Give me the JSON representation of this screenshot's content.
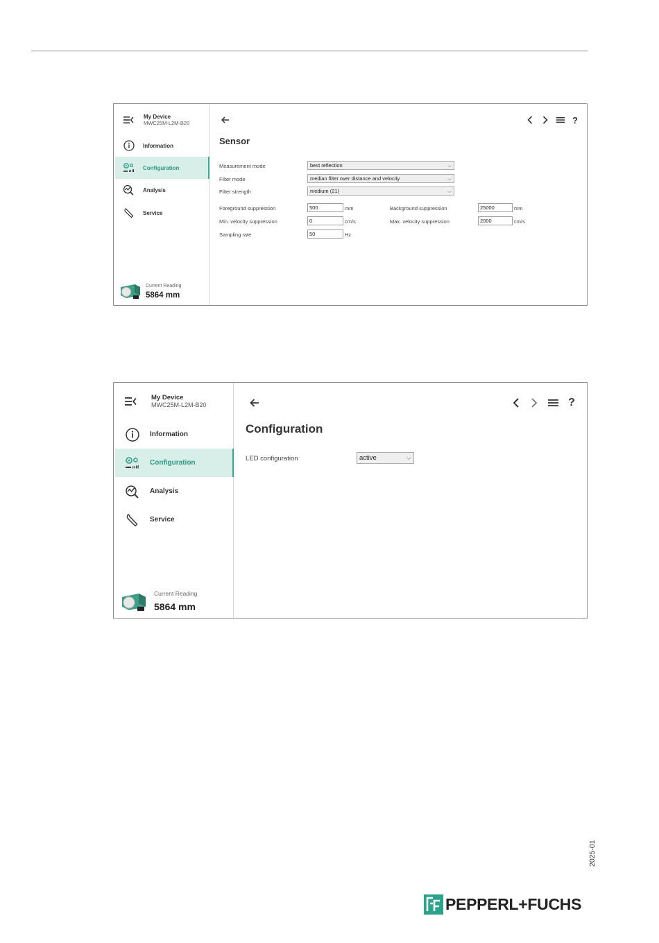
{
  "screens": [
    {
      "device_title": "My Device",
      "device_model": "MWC25M-L2M-B20",
      "nav": [
        {
          "label": "Information",
          "icon": "info-icon",
          "active": false
        },
        {
          "label": "Configuration",
          "icon": "configuration-icon",
          "active": true
        },
        {
          "label": "Analysis",
          "icon": "analysis-icon",
          "active": false
        },
        {
          "label": "Service",
          "icon": "wrench-icon",
          "active": false
        }
      ],
      "reading_label": "Current Reading",
      "reading_value": "5864 mm",
      "toolbar": {
        "back": "back-arrow-icon",
        "prev": "chevron-left-icon",
        "next": "chevron-right-icon",
        "menu": "menu-icon",
        "help": "?"
      },
      "title": "Sensor",
      "selects": [
        {
          "label": "Measurement mode",
          "value": "best reflection"
        },
        {
          "label": "Filter mode",
          "value": "median filter over distance and velocity"
        },
        {
          "label": "Filter strength",
          "value": "medium (21)"
        }
      ],
      "inputs_left": [
        {
          "label": "Foreground suppression",
          "value": "500",
          "unit": "mm"
        },
        {
          "label": "Min. velocity suppression",
          "value": "0",
          "unit": "cm/s"
        },
        {
          "label": "Sampling rate",
          "value": "50",
          "unit": "Hz"
        }
      ],
      "inputs_right": [
        {
          "label": "Background suppression",
          "value": "25000",
          "unit": "mm"
        },
        {
          "label": "Max. velocity suppression",
          "value": "2000",
          "unit": "cm/s"
        }
      ]
    },
    {
      "device_title": "My Device",
      "device_model": "MWC25M-L2M-B20",
      "nav": [
        {
          "label": "Information",
          "icon": "info-icon",
          "active": false
        },
        {
          "label": "Configuration",
          "icon": "configuration-icon",
          "active": true
        },
        {
          "label": "Analysis",
          "icon": "analysis-icon",
          "active": false
        },
        {
          "label": "Service",
          "icon": "wrench-icon",
          "active": false
        }
      ],
      "reading_label": "Current Reading",
      "reading_value": "5864 mm",
      "toolbar": {
        "back": "back-arrow-icon",
        "prev": "chevron-left-icon",
        "next": "chevron-right-icon",
        "menu": "menu-icon",
        "help": "?"
      },
      "title": "Configuration",
      "selects": [
        {
          "label": "LED configuration",
          "value": "active"
        }
      ]
    }
  ],
  "footer": {
    "date_code": "2025-01",
    "brand": "PEPPERL+FUCHS"
  },
  "colors": {
    "accent": "#2aa48a",
    "active_bg": "#d7efe8",
    "active_text": "#2b9a83"
  }
}
